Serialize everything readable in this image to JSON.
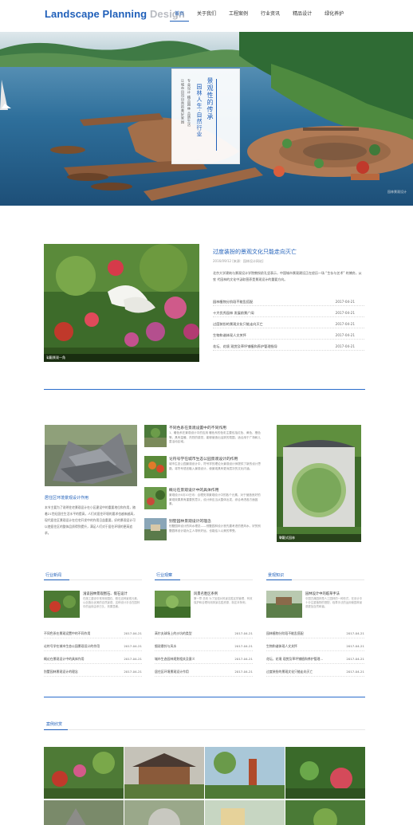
{
  "header": {
    "logo_primary": "Landscape Planning",
    "logo_secondary": "Design",
    "nav": [
      {
        "label": "首页",
        "active": true
      },
      {
        "label": "关于我们",
        "active": false
      },
      {
        "label": "工程案例",
        "active": false
      },
      {
        "label": "行业资讯",
        "active": false
      },
      {
        "label": "精品设计",
        "active": false
      },
      {
        "label": "绿化养护",
        "active": false
      }
    ]
  },
  "banner": {
    "line1": "景观性的传承",
    "line2": "园林人生·自然行业",
    "line3": "专业设计 精品园林 品质生活",
    "line4": "让城市回归自然的美好家园",
    "caption": "园林景观设计"
  },
  "feature": {
    "image_caption": "公园景观一角",
    "pager": "1/2",
    "title": "过度装扮的景观文化只能走向灭亡",
    "meta": "2016/09/12 [来源：园林设计网站]",
    "description": "北京大学建筑与景观设计学院教授俞孔坚表示，中国城市景观建设正在经历一场 “生存与艺术” 的博弈，从农 代园林的文化中汲取营养是景观设计的重要方向。",
    "list": [
      {
        "title": "园林植物分阶段不能乱搭配",
        "date": "2017-04-21"
      },
      {
        "title": "十大优秀园林 发展前景广阔",
        "date": "2017-04-21"
      },
      {
        "title": "过度装扮的景观文化只能走向灭亡",
        "date": "2017-04-21"
      },
      {
        "title": "生物和谐体现人文关怀",
        "date": "2017-04-21"
      },
      {
        "title": "花坛、花境 观赏及草坪铺植和养护管理指导",
        "date": "2017-04-21"
      }
    ]
  },
  "middle": {
    "left_title": "居住区环境景观设计作用",
    "left_desc": "本节主要为了说明住宅景观设计在小区建设中的重要地位和作用，随着21世纪居住生活水平的提高，人们对居住环境的要求也越来越高，现代居住区景观设计在住宅开发中的作用日益重要，好的景观设计可以使居住区的整体品质得到提升，满足人们对于居住环境的更高追求。",
    "items": [
      {
        "title": "不同色系在景观设置中的不同作用",
        "desc": "1、暖色系在景观设计中的应用  暖色系的色彩主要包括红色、黄色、橙色等，具有温暖、热烈的感觉，能够营造出活跃的氛围，适合用于广场和儿童活动区域。"
      },
      {
        "title": "论符号学在城市生态公园景观设计的作用",
        "desc": "城市生态公园景观设计中，符号学的理论为景观设计师提供了新的设计思路，将符号语言融入景观设计，使景观具有更深层次的文化内涵。"
      },
      {
        "title": "概论在景观设计中的具体作用",
        "desc": "景观设计4月10日讯：合理安排景观设计中的各个元素，对于营造良好的景观效果具有重要的意义，设计师应当从整体出发，综合考虑各方面因素。"
      },
      {
        "title": "别墅园林景观设计的理念",
        "desc": "别墅园林设计的风水理念——别墅园林设计首先要考虑的是风水，好的别墅园林设计能为主人带来好运，也能给人以美的享受。"
      }
    ],
    "right_caption": "中国式园林",
    "right_pager": "1/2"
  },
  "columns": [
    {
      "tab": "行业新闻",
      "headline": "浅谈园林景观围石、假石设计",
      "headline_desc": "在施工建设中常采用围石、假石这种景观元素，以创造出优美的自然景观，这种设计手法在园林中的运用由来已久，效果显著。",
      "rows": [
        {
          "title": "不同色系在景观设置中的不同作用",
          "date": "2017-04-21"
        },
        {
          "title": "论符号学在城市生态公园景观设计的作用",
          "date": "2017-04-21"
        },
        {
          "title": "概论在景观设计中的具体作用",
          "date": "2017-04-21"
        },
        {
          "title": "别墅园林景观设计的理念",
          "date": "2017-04-21"
        }
      ]
    },
    {
      "tab": "行业观察",
      "headline": "风景名胜区条例",
      "headline_desc": "第一章 总则 为了加强对风景名胜区的管理，有效保护和合理利用风景名胜资源，制定本条例。",
      "rows": [
        {
          "title": "高尔夫球场上的沙坑的类型",
          "date": "2017-04-21"
        },
        {
          "title": "细说悬铃与风水",
          "date": "2017-04-21"
        },
        {
          "title": "城市生态园林规划相关及意义",
          "date": "2017-04-21"
        },
        {
          "title": "居住区环境景观设计作用",
          "date": "2017-04-21"
        }
      ]
    },
    {
      "tab": "景观知识",
      "headline": "园林设计中的临草手法",
      "headline_desc": "中国古典园林是人工园林的一种形式，在设计中十分注重植物的搭配，临草手法的运用使园林景观更加自然和谐。",
      "rows": [
        {
          "title": "园林植物分阶段不能乱搭配",
          "date": "2017-04-21"
        },
        {
          "title": "生物和谐体现人文关怀",
          "date": "2017-04-21"
        },
        {
          "title": "花坛、花境 观赏及草坪铺植和养护管理…",
          "date": "2017-04-21"
        },
        {
          "title": "过度装扮的景观文化只能走向灭亡",
          "date": "2017-04-21"
        }
      ]
    }
  ],
  "gallery": {
    "tab": "案例欣赏"
  }
}
